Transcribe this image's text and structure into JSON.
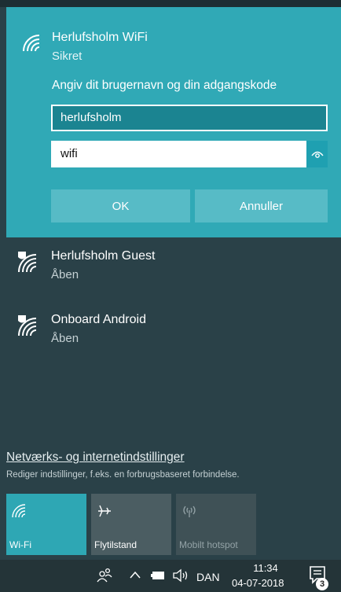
{
  "selected_network": {
    "name": "Herlufsholm WiFi",
    "status": "Sikret",
    "prompt": "Angiv dit brugernavn og din adgangskode",
    "username_value": "herlufsholm",
    "password_value": "wifi",
    "ok_label": "OK",
    "cancel_label": "Annuller"
  },
  "networks": [
    {
      "name": "Herlufsholm Guest",
      "status": "Åben"
    },
    {
      "name": "Onboard Android",
      "status": "Åben"
    }
  ],
  "settings": {
    "link_label": "Netværks- og internetindstillinger",
    "description": "Rediger indstillinger, f.eks. en forbrugsbaseret forbindelse."
  },
  "quick_actions": [
    {
      "label": "Wi-Fi",
      "icon": "wifi-icon",
      "state": "on"
    },
    {
      "label": "Flytilstand",
      "icon": "airplane-icon",
      "state": "off"
    },
    {
      "label": "Mobilt hotspot",
      "icon": "hotspot-icon",
      "state": "disabled"
    }
  ],
  "taskbar": {
    "language": "DAN",
    "time": "11:34",
    "date": "04-07-2018",
    "notification_count": "3"
  },
  "colors": {
    "accent": "#30a9b6",
    "panel_background": "#2a4148",
    "taskbar": "#243438"
  }
}
